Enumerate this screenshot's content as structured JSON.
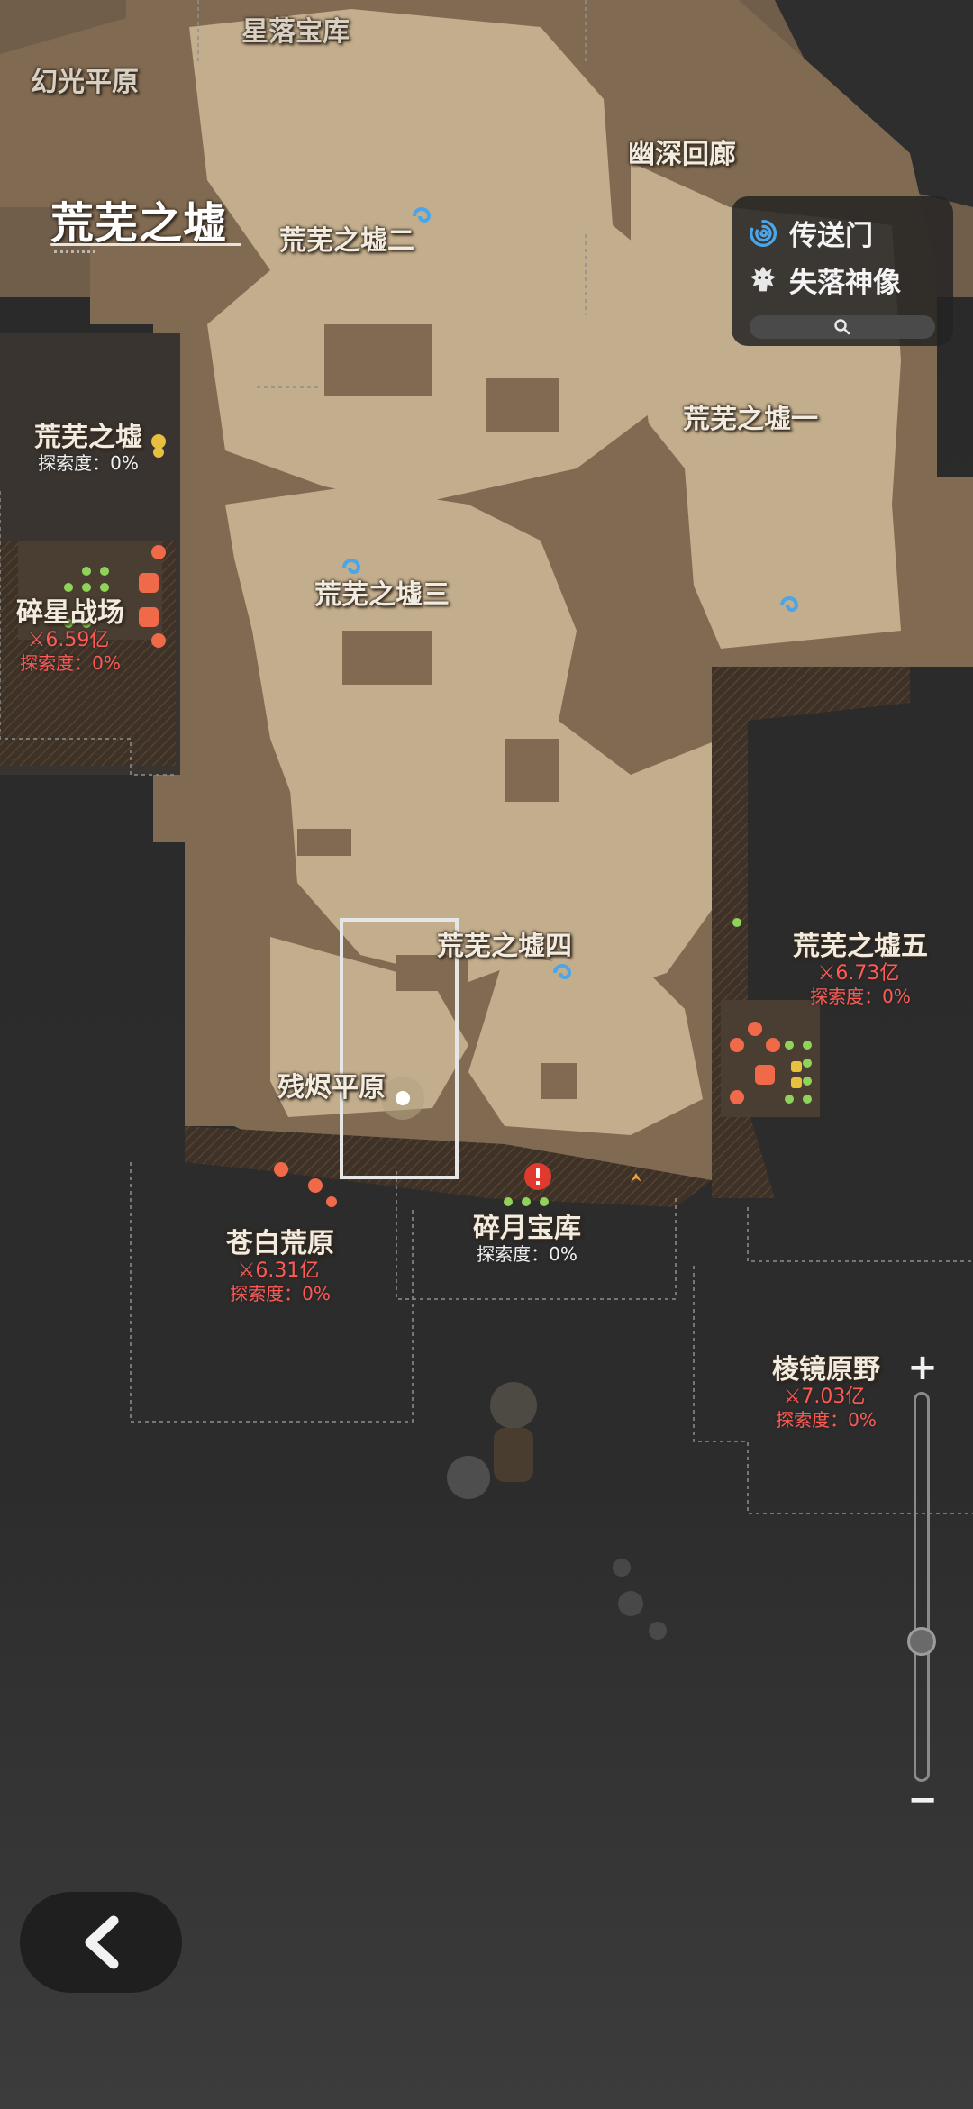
{
  "region_title": "荒芜之墟",
  "legend": {
    "portal_label": "传送门",
    "statue_label": "失落神像",
    "search_icon": "search-icon"
  },
  "areas": [
    {
      "id": "xingluo",
      "name": "星落宝库"
    },
    {
      "id": "huanguang",
      "name": "幻光平原"
    },
    {
      "id": "youshen",
      "name": "幽深回廊"
    },
    {
      "id": "huangwu2",
      "name": "荒芜之墟二"
    },
    {
      "id": "huangwu1",
      "name": "荒芜之墟一"
    },
    {
      "id": "huangwu3",
      "name": "荒芜之墟三"
    },
    {
      "id": "huangwu4",
      "name": "荒芜之墟四"
    },
    {
      "id": "canjin",
      "name": "残烬平原"
    }
  ],
  "region_left": {
    "name": "荒芜之墟",
    "explore": "探索度：0%"
  },
  "suixing": {
    "name": "碎星战场",
    "power": "6.59亿",
    "explore": "探索度：0%"
  },
  "huangwu5": {
    "name": "荒芜之墟五",
    "power": "6.73亿",
    "explore": "探索度：0%"
  },
  "cangbai": {
    "name": "苍白荒原",
    "power": "6.31亿",
    "explore": "探索度：0%"
  },
  "suiyue": {
    "name": "碎月宝库",
    "explore": "探索度：0%"
  },
  "lingjing": {
    "name": "棱镜原野",
    "power": "7.03亿",
    "explore": "探索度：0%"
  },
  "zoom": {
    "plus": "+",
    "minus": "−",
    "level": 0.36
  },
  "colors": {
    "sand_light": "#c2ad8c",
    "sand_dark": "#806a51",
    "warning_red": "#ff5b55",
    "portal_blue": "#4aa6e8"
  }
}
